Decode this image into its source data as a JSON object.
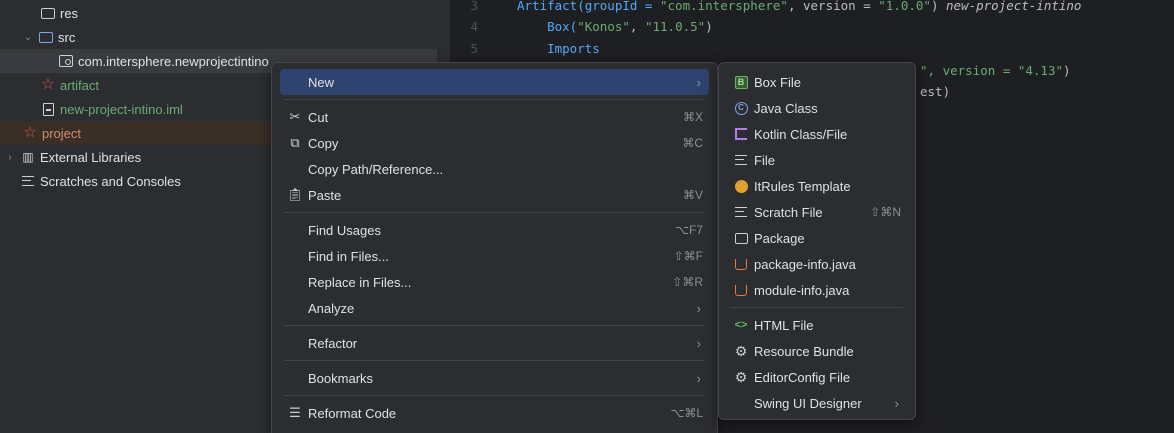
{
  "tree": {
    "items": [
      {
        "label": "res"
      },
      {
        "label": "src"
      },
      {
        "label": "com.intersphere.newprojectintino"
      },
      {
        "label": "artifact"
      },
      {
        "label": "new-project-intino.iml"
      },
      {
        "label": "project"
      },
      {
        "label": "External Libraries"
      },
      {
        "label": "Scratches and Consoles"
      }
    ]
  },
  "editor": {
    "line_numbers": [
      "3",
      "4",
      "5"
    ],
    "line1": {
      "a": "Artifact(groupId = ",
      "b": "\"com.intersphere\"",
      "c": ", version = ",
      "d": "\"1.0.0\"",
      "e": ") ",
      "f": "new-project-intino"
    },
    "line2": {
      "a": "    Box(",
      "b": "\"Konos\"",
      "c": ", ",
      "d": "\"11.0.5\"",
      "e": ")"
    },
    "line3": {
      "a": "    Imports"
    },
    "line4": {
      "a": "\", version = ",
      "b": "\"4.13\"",
      "c": ")"
    },
    "line5": {
      "a": "est)"
    }
  },
  "context_menu": {
    "new": "New",
    "cut": "Cut",
    "cut_sc": "⌘X",
    "copy": "Copy",
    "copy_sc": "⌘C",
    "copy_path": "Copy Path/Reference...",
    "paste": "Paste",
    "paste_sc": "⌘V",
    "find_usages": "Find Usages",
    "find_usages_sc": "⌥F7",
    "find_in_files": "Find in Files...",
    "find_in_files_sc": "⇧⌘F",
    "replace_in_files": "Replace in Files...",
    "replace_in_files_sc": "⇧⌘R",
    "analyze": "Analyze",
    "refactor": "Refactor",
    "bookmarks": "Bookmarks",
    "reformat": "Reformat Code",
    "reformat_sc": "⌥⌘L"
  },
  "new_submenu": {
    "box_file": "Box File",
    "java_class": "Java Class",
    "kotlin": "Kotlin Class/File",
    "file": "File",
    "itrules": "ItRules Template",
    "scratch": "Scratch File",
    "scratch_sc": "⇧⌘N",
    "package": "Package",
    "package_info": "package-info.java",
    "module_info": "module-info.java",
    "html": "HTML File",
    "resource_bundle": "Resource Bundle",
    "editorconfig": "EditorConfig File",
    "swing": "Swing UI Designer"
  },
  "colors": {
    "accent": "#2e436e",
    "string": "#6aab73",
    "keyword": "#56a8f5"
  }
}
